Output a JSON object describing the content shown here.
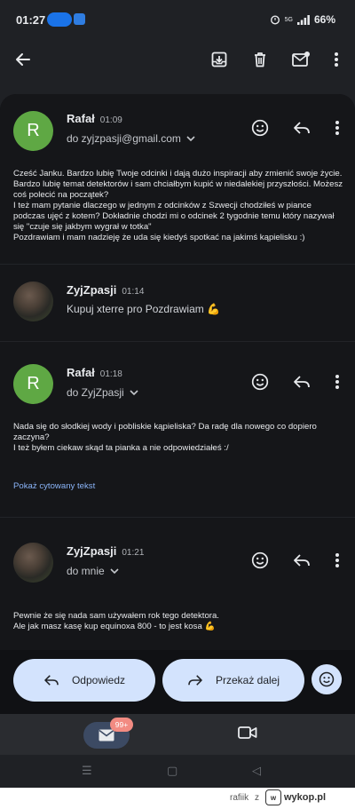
{
  "status_bar": {
    "time": "01:27",
    "network": "5G",
    "battery": "66%"
  },
  "messages": [
    {
      "sender": "Rafał",
      "time": "01:09",
      "avatar_letter": "R",
      "recipient": "do zyjzpasji@gmail.com",
      "body": "Cześć Janku. Bardzo lubię Twoje odcinki i dają dużo inspiracji aby zmienić swoje życie. Bardzo lubię temat detektorów i sam chciałbym kupić w niedalekiej przyszłości. Możesz coś polecić na początek?\nI też mam pytanie dlaczego w jednym z odcinków z Szwecji chodziłeś w piance podczas ujęć z kotem? Dokładnie chodzi mi o odcinek 2 tygodnie temu który nazywał się \"czuje się jakbym wygrał w totka\"\nPozdrawiam i mam nadzieję że uda się kiedyś spotkać na jakimś kąpielisku :)"
    },
    {
      "sender": "ZyjZpasji",
      "time": "01:14",
      "snippet": "Kupuj xterre pro Pozdrawiam 💪"
    },
    {
      "sender": "Rafał",
      "time": "01:18",
      "avatar_letter": "R",
      "recipient": "do ZyjZpasji",
      "body": "Nada się do słodkiej wody i pobliskie kąpieliska? Da radę dla nowego co dopiero zaczyna?\nI też byłem ciekaw skąd ta pianka a nie odpowiedziałeś :/",
      "quoted_link": "Pokaż cytowany tekst"
    },
    {
      "sender": "ZyjZpasji",
      "time": "01:21",
      "recipient": "do mnie",
      "body": "Pewnie że się nada sam używałem rok tego detektora.\nAle jak masz kasę kup equinoxa 800 - to jest kosa 💪"
    }
  ],
  "actions": {
    "reply": "Odpowiedz",
    "forward": "Przekaż dalej"
  },
  "bottom_nav": {
    "mail_badge": "99+"
  },
  "footer": {
    "user": "rafiik",
    "gender": "z",
    "site": "wykop.pl",
    "logo_mark": "w"
  },
  "colors": {
    "background": "#1f2125",
    "avatar_green": "#5fa844",
    "button_blue": "#d3e3fd",
    "link_blue": "#8ab4f8",
    "badge_red": "#f28b82"
  }
}
